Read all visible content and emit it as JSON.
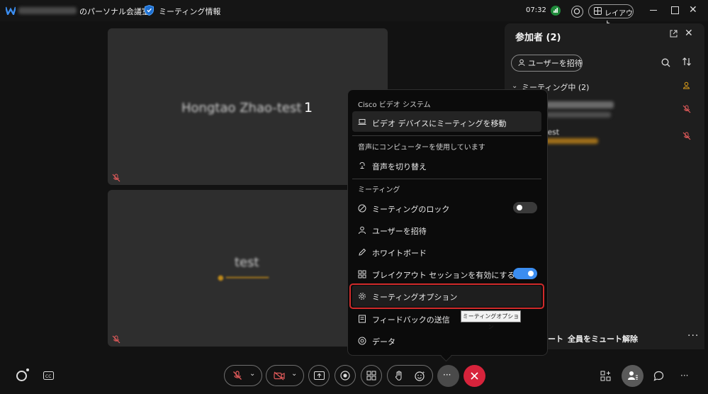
{
  "titlebar": {
    "host_suffix": "のパーソナル会議室",
    "meeting_info": "ミーティング情報",
    "time": "07:32",
    "layout_label": "レイアウト"
  },
  "tiles": [
    {
      "name": "Hongtao Zhao-test",
      "name_suffix": "1"
    },
    {
      "name": "test"
    }
  ],
  "participants": {
    "title": "参加者 (2)",
    "invite_label": "ユーザーを招待",
    "section_label": "ミーティング中 (2)",
    "people": [
      {
        "name": "test"
      }
    ],
    "mute_all_fragment": "ート",
    "unmute_all": "全員をミュート解除"
  },
  "menu": {
    "section_device": "Cisco ビデオ システム",
    "move_to_device": "ビデオ デバイスにミーティングを移動",
    "section_audio": "音声にコンピューターを使用しています",
    "switch_audio": "音声を切り替え",
    "section_meeting": "ミーティング",
    "lock_meeting": "ミーティングのロック",
    "lock_on": false,
    "invite_users": "ユーザーを招待",
    "whiteboard": "ホワイトボード",
    "breakout": "ブレイクアウト セッションを有効にする",
    "breakout_on": true,
    "meeting_options": "ミーティングオプション",
    "feedback": "フィードバックの送信",
    "data": "データ"
  },
  "tooltip": "ミーティングオプション",
  "colors": {
    "accent_blue": "#3b8df0",
    "end_red": "#d7233b",
    "muted_red": "#e05a5a",
    "highlight_red": "#d12a2a"
  }
}
